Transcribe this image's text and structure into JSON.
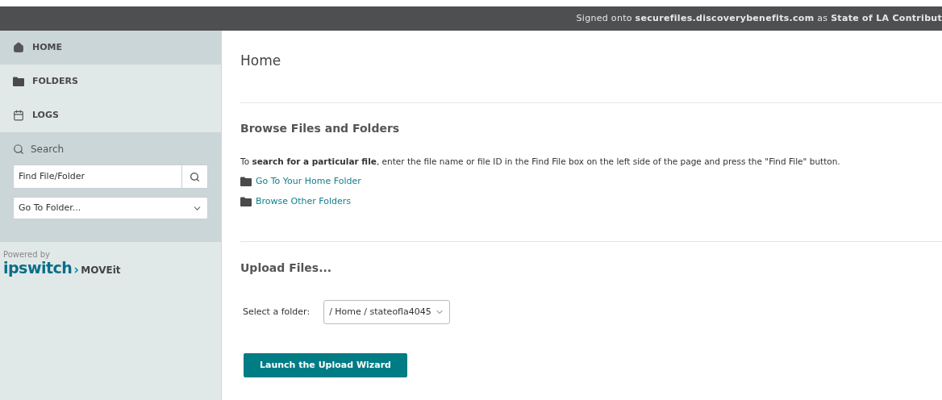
{
  "top_bar": {
    "text": "Signed onto **securefiles.discoverybenefits.com** as **State of LA Contribut**"
  },
  "sidebar": {
    "nav": [
      {
        "kind": "home",
        "label": "HOME",
        "selected": true
      },
      {
        "kind": "folders",
        "label": "FOLDERS",
        "selected": false
      },
      {
        "kind": "logs",
        "label": "LOGS",
        "selected": false
      }
    ],
    "search": {
      "title": "Search",
      "find_field": {
        "placeholder": "Find File/Folder"
      },
      "goto_select": {
        "value": "Go To Folder..."
      }
    },
    "powered_by": "Powered by",
    "logo": {
      "brand": "ipswitch",
      "product": "MOVEit"
    }
  },
  "main": {
    "title": "Home",
    "browse": {
      "heading": "Browse Files and Folders",
      "instruction": "To **search for a particular file**, enter the file name or file ID in the Find File box on the left side of the page and press the \"Find File\" button.",
      "links": [
        "Go To Your Home Folder",
        "Browse Other Folders"
      ]
    },
    "upload": {
      "heading": "Upload Files...",
      "select_label": "Select a folder:",
      "select_value": "/ Home / stateofla4045",
      "button": "Launch the Upload Wizard"
    }
  }
}
